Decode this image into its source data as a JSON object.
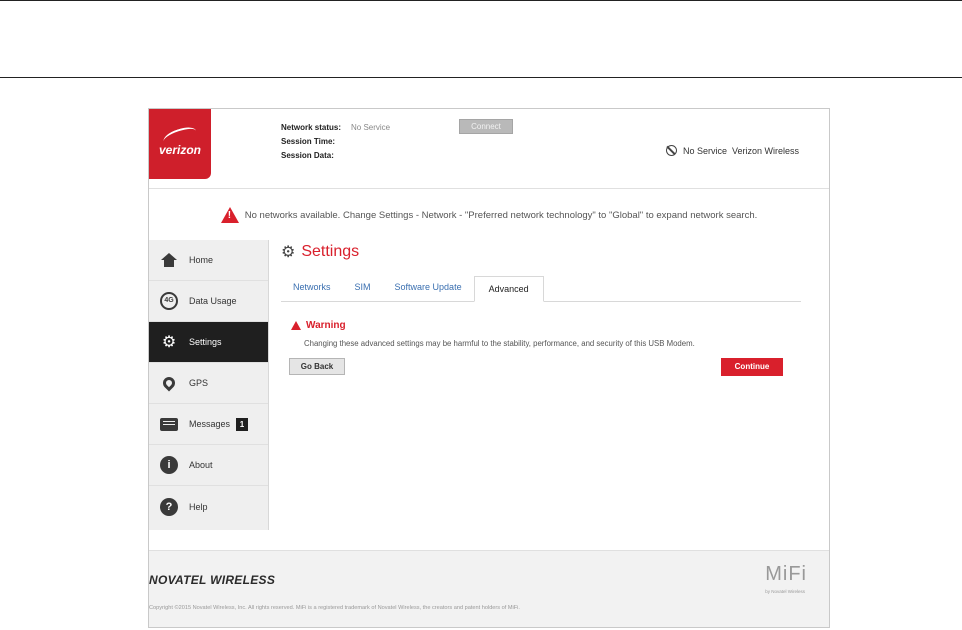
{
  "header": {
    "logo_text": "verizon",
    "network_status_label": "Network status:",
    "network_status_value": "No Service",
    "session_time_label": "Session Time:",
    "session_time_value": "",
    "session_data_label": "Session Data:",
    "session_data_value": "",
    "connect_label": "Connect",
    "service_text": "No Service  Verizon Wireless"
  },
  "alert": {
    "text": "No networks available. Change Settings - Network - \"Preferred network technology\" to \"Global\" to expand network search."
  },
  "sidebar": {
    "items": [
      {
        "label": "Home",
        "icon": "home-icon"
      },
      {
        "label": "Data Usage",
        "icon": "data-usage-icon"
      },
      {
        "label": "Settings",
        "icon": "gear-icon",
        "active": true
      },
      {
        "label": "GPS",
        "icon": "location-pin-icon"
      },
      {
        "label": "Messages",
        "icon": "message-icon",
        "badge": "1"
      },
      {
        "label": "About",
        "icon": "info-icon"
      },
      {
        "label": "Help",
        "icon": "help-icon"
      }
    ]
  },
  "main": {
    "title": "Settings",
    "tabs": [
      {
        "label": "Networks"
      },
      {
        "label": "SIM"
      },
      {
        "label": "Software Update"
      },
      {
        "label": "Advanced",
        "active": true
      }
    ],
    "warning_title": "Warning",
    "warning_text": "Changing these advanced settings may be harmful to the stability, performance, and security of this USB Modem.",
    "go_back_label": "Go Back",
    "continue_label": "Continue"
  },
  "footer": {
    "brand": "NOVATEL WIRELESS",
    "mifi": "MiFi",
    "mifi_sub": "by Novatel Wireless",
    "copyright": "Copyright ©2015 Novatel Wireless, Inc. All rights reserved. MiFi is a registered trademark of Novatel Wireless, the creators and patent holders of MiFi."
  },
  "colors": {
    "accent": "#d9202c",
    "logo_bg": "#cf1f2b",
    "sidebar_active": "#1f1f1f",
    "link": "#3a6fb0"
  }
}
